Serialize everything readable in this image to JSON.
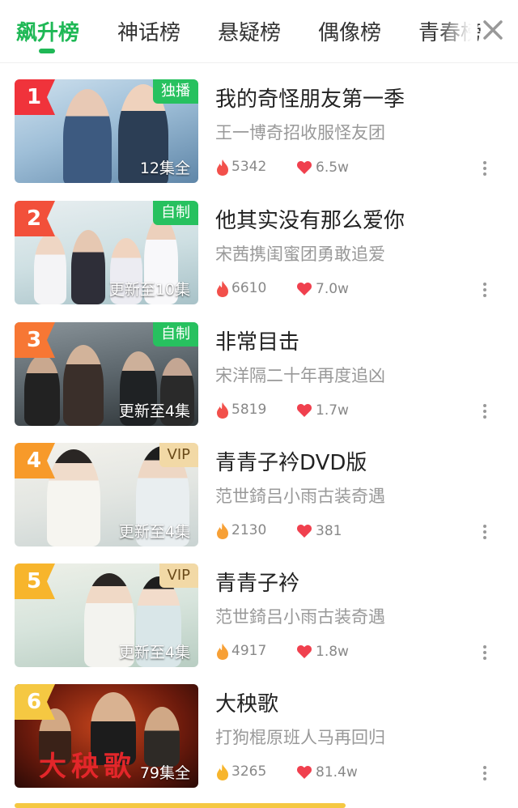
{
  "tabs": [
    {
      "label": "飙升榜",
      "active": true
    },
    {
      "label": "神话榜",
      "active": false
    },
    {
      "label": "悬疑榜",
      "active": false
    },
    {
      "label": "偶像榜",
      "active": false
    },
    {
      "label": "青春榜",
      "active": false
    }
  ],
  "close_icon": "close-icon",
  "colors": {
    "accent": "#1fb856",
    "rank1": "#f0333b",
    "rank2": "#f2503a",
    "rank3": "#f77734",
    "rank4": "#f79a2a",
    "rank5": "#f7b52c",
    "rank6": "#f5c842",
    "badge_green": "#27c15f",
    "badge_vip": "#f2d9a6",
    "hot_red": "#f2504b",
    "hot_orange": "#f7a036",
    "heart": "#f0404e"
  },
  "items": [
    {
      "rank": "1",
      "title": "我的奇怪朋友第一季",
      "subtitle": "王一博奇招收服怪友团",
      "badge": "独播",
      "badge_type": "green",
      "episodes": "12集全",
      "hot": "5342",
      "likes": "6.5w",
      "hot_color": "red"
    },
    {
      "rank": "2",
      "title": "他其实没有那么爱你",
      "subtitle": "宋茜携闺蜜团勇敢追爱",
      "badge": "自制",
      "badge_type": "green",
      "episodes": "更新至10集",
      "hot": "6610",
      "likes": "7.0w",
      "hot_color": "red"
    },
    {
      "rank": "3",
      "title": "非常目击",
      "subtitle": "宋洋隔二十年再度追凶",
      "badge": "自制",
      "badge_type": "green",
      "episodes": "更新至4集",
      "hot": "5819",
      "likes": "1.7w",
      "hot_color": "red"
    },
    {
      "rank": "4",
      "title": "青青子衿DVD版",
      "subtitle": "范世錡吕小雨古装奇遇",
      "badge": "VIP",
      "badge_type": "vip",
      "episodes": "更新至4集",
      "hot": "2130",
      "likes": "381",
      "hot_color": "orange"
    },
    {
      "rank": "5",
      "title": "青青子衿",
      "subtitle": "范世錡吕小雨古装奇遇",
      "badge": "VIP",
      "badge_type": "vip",
      "episodes": "更新至4集",
      "hot": "4917",
      "likes": "1.8w",
      "hot_color": "orange"
    },
    {
      "rank": "6",
      "title": "大秧歌",
      "subtitle": "打狗棍原班人马再回归",
      "badge": "",
      "badge_type": "none",
      "episodes": "79集全",
      "hot": "3265",
      "likes": "81.4w",
      "hot_color": "orange"
    }
  ]
}
